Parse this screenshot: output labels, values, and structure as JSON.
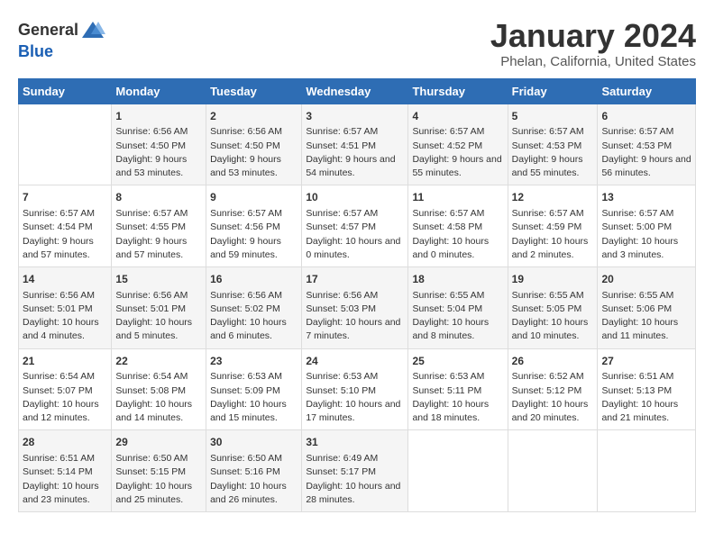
{
  "logo": {
    "general": "General",
    "blue": "Blue"
  },
  "title": "January 2024",
  "location": "Phelan, California, United States",
  "days_of_week": [
    "Sunday",
    "Monday",
    "Tuesday",
    "Wednesday",
    "Thursday",
    "Friday",
    "Saturday"
  ],
  "weeks": [
    [
      {
        "day": "",
        "sunrise": "",
        "sunset": "",
        "daylight": ""
      },
      {
        "day": "1",
        "sunrise": "Sunrise: 6:56 AM",
        "sunset": "Sunset: 4:50 PM",
        "daylight": "Daylight: 9 hours and 53 minutes."
      },
      {
        "day": "2",
        "sunrise": "Sunrise: 6:56 AM",
        "sunset": "Sunset: 4:50 PM",
        "daylight": "Daylight: 9 hours and 53 minutes."
      },
      {
        "day": "3",
        "sunrise": "Sunrise: 6:57 AM",
        "sunset": "Sunset: 4:51 PM",
        "daylight": "Daylight: 9 hours and 54 minutes."
      },
      {
        "day": "4",
        "sunrise": "Sunrise: 6:57 AM",
        "sunset": "Sunset: 4:52 PM",
        "daylight": "Daylight: 9 hours and 55 minutes."
      },
      {
        "day": "5",
        "sunrise": "Sunrise: 6:57 AM",
        "sunset": "Sunset: 4:53 PM",
        "daylight": "Daylight: 9 hours and 55 minutes."
      },
      {
        "day": "6",
        "sunrise": "Sunrise: 6:57 AM",
        "sunset": "Sunset: 4:53 PM",
        "daylight": "Daylight: 9 hours and 56 minutes."
      }
    ],
    [
      {
        "day": "7",
        "sunrise": "Sunrise: 6:57 AM",
        "sunset": "Sunset: 4:54 PM",
        "daylight": "Daylight: 9 hours and 57 minutes."
      },
      {
        "day": "8",
        "sunrise": "Sunrise: 6:57 AM",
        "sunset": "Sunset: 4:55 PM",
        "daylight": "Daylight: 9 hours and 57 minutes."
      },
      {
        "day": "9",
        "sunrise": "Sunrise: 6:57 AM",
        "sunset": "Sunset: 4:56 PM",
        "daylight": "Daylight: 9 hours and 59 minutes."
      },
      {
        "day": "10",
        "sunrise": "Sunrise: 6:57 AM",
        "sunset": "Sunset: 4:57 PM",
        "daylight": "Daylight: 10 hours and 0 minutes."
      },
      {
        "day": "11",
        "sunrise": "Sunrise: 6:57 AM",
        "sunset": "Sunset: 4:58 PM",
        "daylight": "Daylight: 10 hours and 0 minutes."
      },
      {
        "day": "12",
        "sunrise": "Sunrise: 6:57 AM",
        "sunset": "Sunset: 4:59 PM",
        "daylight": "Daylight: 10 hours and 2 minutes."
      },
      {
        "day": "13",
        "sunrise": "Sunrise: 6:57 AM",
        "sunset": "Sunset: 5:00 PM",
        "daylight": "Daylight: 10 hours and 3 minutes."
      }
    ],
    [
      {
        "day": "14",
        "sunrise": "Sunrise: 6:56 AM",
        "sunset": "Sunset: 5:01 PM",
        "daylight": "Daylight: 10 hours and 4 minutes."
      },
      {
        "day": "15",
        "sunrise": "Sunrise: 6:56 AM",
        "sunset": "Sunset: 5:01 PM",
        "daylight": "Daylight: 10 hours and 5 minutes."
      },
      {
        "day": "16",
        "sunrise": "Sunrise: 6:56 AM",
        "sunset": "Sunset: 5:02 PM",
        "daylight": "Daylight: 10 hours and 6 minutes."
      },
      {
        "day": "17",
        "sunrise": "Sunrise: 6:56 AM",
        "sunset": "Sunset: 5:03 PM",
        "daylight": "Daylight: 10 hours and 7 minutes."
      },
      {
        "day": "18",
        "sunrise": "Sunrise: 6:55 AM",
        "sunset": "Sunset: 5:04 PM",
        "daylight": "Daylight: 10 hours and 8 minutes."
      },
      {
        "day": "19",
        "sunrise": "Sunrise: 6:55 AM",
        "sunset": "Sunset: 5:05 PM",
        "daylight": "Daylight: 10 hours and 10 minutes."
      },
      {
        "day": "20",
        "sunrise": "Sunrise: 6:55 AM",
        "sunset": "Sunset: 5:06 PM",
        "daylight": "Daylight: 10 hours and 11 minutes."
      }
    ],
    [
      {
        "day": "21",
        "sunrise": "Sunrise: 6:54 AM",
        "sunset": "Sunset: 5:07 PM",
        "daylight": "Daylight: 10 hours and 12 minutes."
      },
      {
        "day": "22",
        "sunrise": "Sunrise: 6:54 AM",
        "sunset": "Sunset: 5:08 PM",
        "daylight": "Daylight: 10 hours and 14 minutes."
      },
      {
        "day": "23",
        "sunrise": "Sunrise: 6:53 AM",
        "sunset": "Sunset: 5:09 PM",
        "daylight": "Daylight: 10 hours and 15 minutes."
      },
      {
        "day": "24",
        "sunrise": "Sunrise: 6:53 AM",
        "sunset": "Sunset: 5:10 PM",
        "daylight": "Daylight: 10 hours and 17 minutes."
      },
      {
        "day": "25",
        "sunrise": "Sunrise: 6:53 AM",
        "sunset": "Sunset: 5:11 PM",
        "daylight": "Daylight: 10 hours and 18 minutes."
      },
      {
        "day": "26",
        "sunrise": "Sunrise: 6:52 AM",
        "sunset": "Sunset: 5:12 PM",
        "daylight": "Daylight: 10 hours and 20 minutes."
      },
      {
        "day": "27",
        "sunrise": "Sunrise: 6:51 AM",
        "sunset": "Sunset: 5:13 PM",
        "daylight": "Daylight: 10 hours and 21 minutes."
      }
    ],
    [
      {
        "day": "28",
        "sunrise": "Sunrise: 6:51 AM",
        "sunset": "Sunset: 5:14 PM",
        "daylight": "Daylight: 10 hours and 23 minutes."
      },
      {
        "day": "29",
        "sunrise": "Sunrise: 6:50 AM",
        "sunset": "Sunset: 5:15 PM",
        "daylight": "Daylight: 10 hours and 25 minutes."
      },
      {
        "day": "30",
        "sunrise": "Sunrise: 6:50 AM",
        "sunset": "Sunset: 5:16 PM",
        "daylight": "Daylight: 10 hours and 26 minutes."
      },
      {
        "day": "31",
        "sunrise": "Sunrise: 6:49 AM",
        "sunset": "Sunset: 5:17 PM",
        "daylight": "Daylight: 10 hours and 28 minutes."
      },
      {
        "day": "",
        "sunrise": "",
        "sunset": "",
        "daylight": ""
      },
      {
        "day": "",
        "sunrise": "",
        "sunset": "",
        "daylight": ""
      },
      {
        "day": "",
        "sunrise": "",
        "sunset": "",
        "daylight": ""
      }
    ]
  ]
}
